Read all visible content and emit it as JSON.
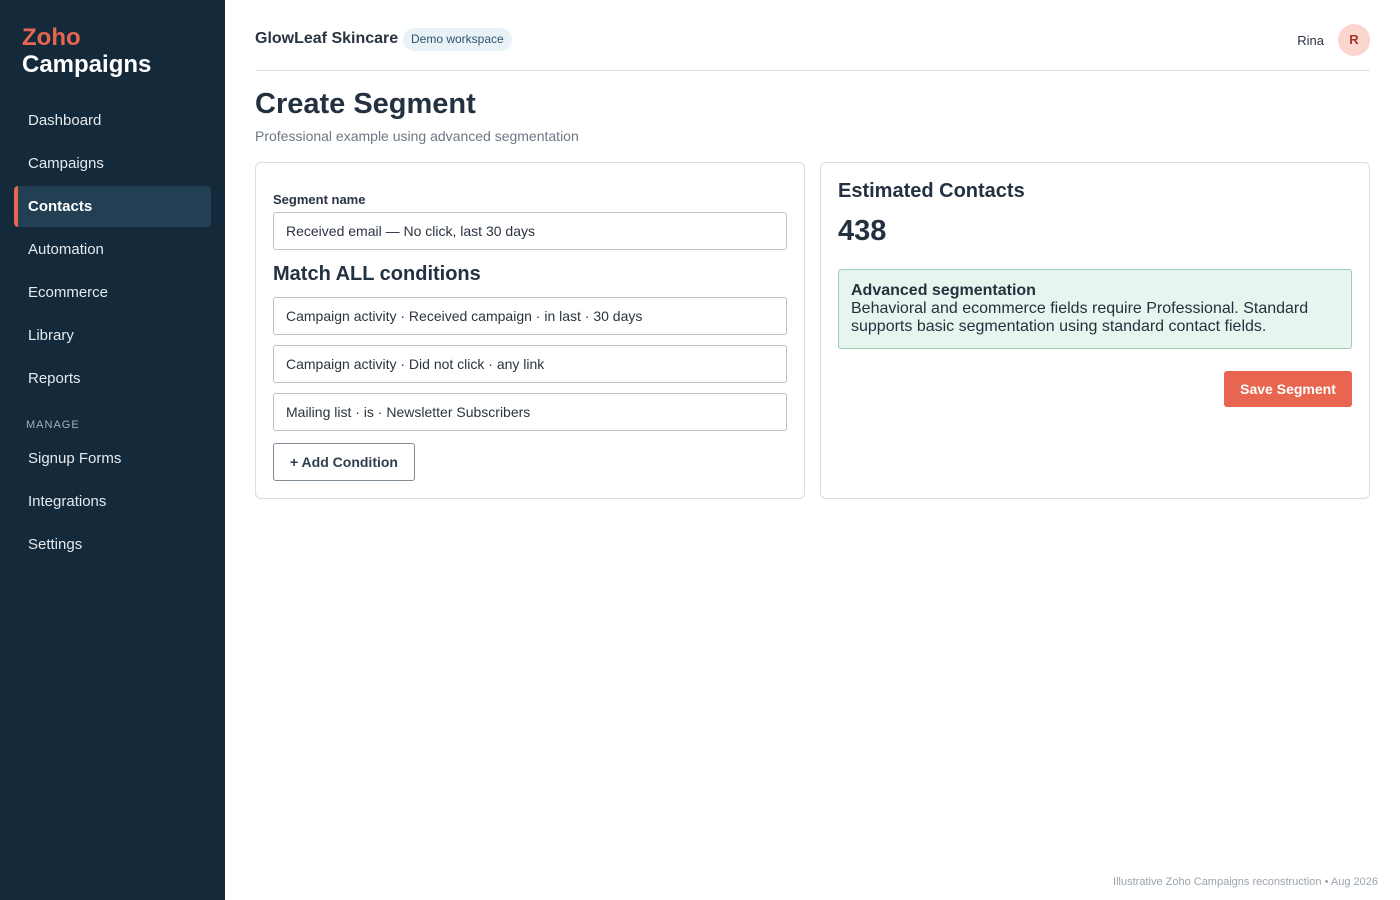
{
  "brand": {
    "line1": "Zoho",
    "line2": "Campaigns"
  },
  "sidebar": {
    "items": [
      {
        "label": "Dashboard"
      },
      {
        "label": "Campaigns"
      },
      {
        "label": "Contacts",
        "active": true
      },
      {
        "label": "Automation"
      },
      {
        "label": "Ecommerce"
      },
      {
        "label": "Library"
      },
      {
        "label": "Reports"
      }
    ],
    "section_label": "MANAGE",
    "manage_items": [
      {
        "label": "Signup Forms"
      },
      {
        "label": "Integrations"
      },
      {
        "label": "Settings"
      }
    ]
  },
  "header": {
    "org_name": "GlowLeaf Skincare",
    "workspace_badge": "Demo workspace",
    "user_name": "Rina",
    "avatar_initial": "R"
  },
  "page": {
    "title": "Create Segment",
    "subtitle": "Professional example using advanced segmentation"
  },
  "segment_form": {
    "name_label": "Segment name",
    "name_value": "Received email — No click, last 30 days",
    "match_heading": "Match ALL conditions",
    "conditions": [
      "Campaign activity · Received campaign · in last · 30 days",
      "Campaign activity · Did not click · any link",
      "Mailing list · is · Newsletter Subscribers"
    ],
    "add_condition_label": "+ Add Condition"
  },
  "estimate": {
    "title": "Estimated Contacts",
    "count": "438",
    "notice_title": "Advanced segmentation",
    "notice_body": "Behavioral and ecommerce fields require Professional. Standard supports basic segmentation using standard contact fields.",
    "save_label": "Save Segment"
  },
  "footer": {
    "text": "Illustrative Zoho Campaigns reconstruction • Aug 2026"
  },
  "colors": {
    "sidebar_bg": "#142a3a",
    "accent": "#e8654f",
    "active_item_bg": "#223f53",
    "notice_bg": "#e8f5ee",
    "notice_border": "#9ccfb3"
  }
}
